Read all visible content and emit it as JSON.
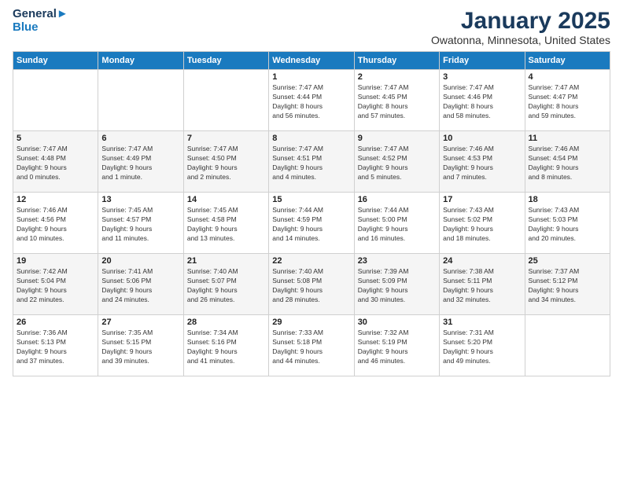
{
  "logo": {
    "line1": "General",
    "line2": "Blue"
  },
  "title": "January 2025",
  "subtitle": "Owatonna, Minnesota, United States",
  "days_of_week": [
    "Sunday",
    "Monday",
    "Tuesday",
    "Wednesday",
    "Thursday",
    "Friday",
    "Saturday"
  ],
  "weeks": [
    [
      {
        "day": "",
        "info": ""
      },
      {
        "day": "",
        "info": ""
      },
      {
        "day": "",
        "info": ""
      },
      {
        "day": "1",
        "info": "Sunrise: 7:47 AM\nSunset: 4:44 PM\nDaylight: 8 hours\nand 56 minutes."
      },
      {
        "day": "2",
        "info": "Sunrise: 7:47 AM\nSunset: 4:45 PM\nDaylight: 8 hours\nand 57 minutes."
      },
      {
        "day": "3",
        "info": "Sunrise: 7:47 AM\nSunset: 4:46 PM\nDaylight: 8 hours\nand 58 minutes."
      },
      {
        "day": "4",
        "info": "Sunrise: 7:47 AM\nSunset: 4:47 PM\nDaylight: 8 hours\nand 59 minutes."
      }
    ],
    [
      {
        "day": "5",
        "info": "Sunrise: 7:47 AM\nSunset: 4:48 PM\nDaylight: 9 hours\nand 0 minutes."
      },
      {
        "day": "6",
        "info": "Sunrise: 7:47 AM\nSunset: 4:49 PM\nDaylight: 9 hours\nand 1 minute."
      },
      {
        "day": "7",
        "info": "Sunrise: 7:47 AM\nSunset: 4:50 PM\nDaylight: 9 hours\nand 2 minutes."
      },
      {
        "day": "8",
        "info": "Sunrise: 7:47 AM\nSunset: 4:51 PM\nDaylight: 9 hours\nand 4 minutes."
      },
      {
        "day": "9",
        "info": "Sunrise: 7:47 AM\nSunset: 4:52 PM\nDaylight: 9 hours\nand 5 minutes."
      },
      {
        "day": "10",
        "info": "Sunrise: 7:46 AM\nSunset: 4:53 PM\nDaylight: 9 hours\nand 7 minutes."
      },
      {
        "day": "11",
        "info": "Sunrise: 7:46 AM\nSunset: 4:54 PM\nDaylight: 9 hours\nand 8 minutes."
      }
    ],
    [
      {
        "day": "12",
        "info": "Sunrise: 7:46 AM\nSunset: 4:56 PM\nDaylight: 9 hours\nand 10 minutes."
      },
      {
        "day": "13",
        "info": "Sunrise: 7:45 AM\nSunset: 4:57 PM\nDaylight: 9 hours\nand 11 minutes."
      },
      {
        "day": "14",
        "info": "Sunrise: 7:45 AM\nSunset: 4:58 PM\nDaylight: 9 hours\nand 13 minutes."
      },
      {
        "day": "15",
        "info": "Sunrise: 7:44 AM\nSunset: 4:59 PM\nDaylight: 9 hours\nand 14 minutes."
      },
      {
        "day": "16",
        "info": "Sunrise: 7:44 AM\nSunset: 5:00 PM\nDaylight: 9 hours\nand 16 minutes."
      },
      {
        "day": "17",
        "info": "Sunrise: 7:43 AM\nSunset: 5:02 PM\nDaylight: 9 hours\nand 18 minutes."
      },
      {
        "day": "18",
        "info": "Sunrise: 7:43 AM\nSunset: 5:03 PM\nDaylight: 9 hours\nand 20 minutes."
      }
    ],
    [
      {
        "day": "19",
        "info": "Sunrise: 7:42 AM\nSunset: 5:04 PM\nDaylight: 9 hours\nand 22 minutes."
      },
      {
        "day": "20",
        "info": "Sunrise: 7:41 AM\nSunset: 5:06 PM\nDaylight: 9 hours\nand 24 minutes."
      },
      {
        "day": "21",
        "info": "Sunrise: 7:40 AM\nSunset: 5:07 PM\nDaylight: 9 hours\nand 26 minutes."
      },
      {
        "day": "22",
        "info": "Sunrise: 7:40 AM\nSunset: 5:08 PM\nDaylight: 9 hours\nand 28 minutes."
      },
      {
        "day": "23",
        "info": "Sunrise: 7:39 AM\nSunset: 5:09 PM\nDaylight: 9 hours\nand 30 minutes."
      },
      {
        "day": "24",
        "info": "Sunrise: 7:38 AM\nSunset: 5:11 PM\nDaylight: 9 hours\nand 32 minutes."
      },
      {
        "day": "25",
        "info": "Sunrise: 7:37 AM\nSunset: 5:12 PM\nDaylight: 9 hours\nand 34 minutes."
      }
    ],
    [
      {
        "day": "26",
        "info": "Sunrise: 7:36 AM\nSunset: 5:13 PM\nDaylight: 9 hours\nand 37 minutes."
      },
      {
        "day": "27",
        "info": "Sunrise: 7:35 AM\nSunset: 5:15 PM\nDaylight: 9 hours\nand 39 minutes."
      },
      {
        "day": "28",
        "info": "Sunrise: 7:34 AM\nSunset: 5:16 PM\nDaylight: 9 hours\nand 41 minutes."
      },
      {
        "day": "29",
        "info": "Sunrise: 7:33 AM\nSunset: 5:18 PM\nDaylight: 9 hours\nand 44 minutes."
      },
      {
        "day": "30",
        "info": "Sunrise: 7:32 AM\nSunset: 5:19 PM\nDaylight: 9 hours\nand 46 minutes."
      },
      {
        "day": "31",
        "info": "Sunrise: 7:31 AM\nSunset: 5:20 PM\nDaylight: 9 hours\nand 49 minutes."
      },
      {
        "day": "",
        "info": ""
      }
    ]
  ]
}
